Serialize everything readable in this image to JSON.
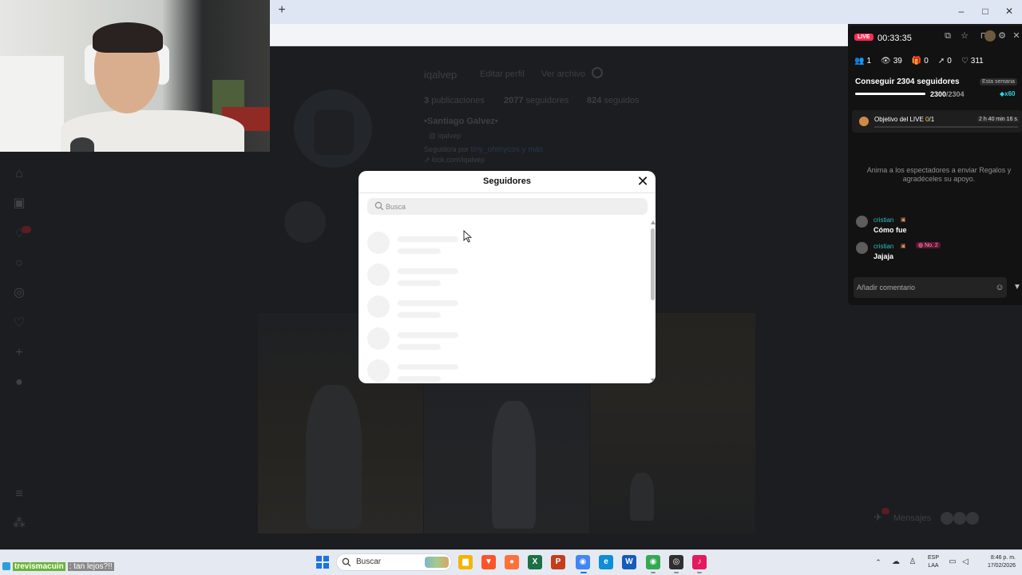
{
  "browser": {
    "new_tab_glyph": "+",
    "win_min_glyph": "–",
    "win_max_glyph": "□",
    "win_close_glyph": "✕"
  },
  "profile": {
    "username": "iqalvep",
    "edit_button": "Editar perfil",
    "archive_button": "Ver archivo",
    "stats": [
      {
        "value": "3",
        "label": "publicaciones"
      },
      {
        "value": "2077",
        "label": "seguidores"
      },
      {
        "value": "824",
        "label": "seguidos"
      }
    ],
    "display_name": "•Santiago Galvez•",
    "threads_handle": "iqalvep",
    "followed_by_prefix": "Seguido/a por",
    "followed_by_names": "tiny_ohmycos y más",
    "link": "kick.com/iqalvep"
  },
  "messages_pill": {
    "label": "Mensajes"
  },
  "modal": {
    "title": "Seguidores",
    "close_glyph": "✕",
    "search_placeholder": "Busca"
  },
  "live": {
    "badge": "LIVE",
    "timer": "00:33:35",
    "stats": [
      {
        "icon": "users-icon",
        "glyph": "👥",
        "value": "1"
      },
      {
        "icon": "eye-icon",
        "glyph": "👁",
        "value": "39"
      },
      {
        "icon": "gift-icon",
        "glyph": "🎁",
        "value": "0"
      },
      {
        "icon": "user-add-icon",
        "glyph": "➚",
        "value": "0"
      },
      {
        "icon": "heart-icon",
        "glyph": "♡",
        "value": "311"
      }
    ],
    "goal": {
      "title": "Conseguir 2304 seguidores",
      "period": "Esta semana",
      "current": "2300",
      "total": "/2304",
      "progress": 0.998,
      "reward": "x60"
    },
    "live_goal": {
      "label": "Objetivo del LIVE",
      "progress_current": "0",
      "progress_total": "/1",
      "time_left": "2 h 40 min 16 s"
    },
    "hint": "Anima a los espectadores a enviar Regalos y agradéceles su apoyo.",
    "chat": [
      {
        "name": "cristian",
        "text": "Cómo fue",
        "rank": ""
      },
      {
        "name": "cristian",
        "text": "Jajaja",
        "rank": "No. 2"
      }
    ],
    "comment_placeholder": "Añadir comentario"
  },
  "taskbar": {
    "ticker_user": "trevismacuin",
    "ticker_message": ": tan lejos?!!",
    "search_label": "Buscar",
    "lang_line1": "ESP",
    "lang_line2": "LAA",
    "time": "8:46 p. m.",
    "date": "17/02/2026",
    "apps": [
      {
        "name": "file-explorer-icon",
        "glyph": "▆",
        "color": "#f4b400"
      },
      {
        "name": "brave-icon",
        "glyph": "▼",
        "color": "#fb542b"
      },
      {
        "name": "firefox-icon",
        "glyph": "●",
        "color": "#ff7139"
      },
      {
        "name": "excel-icon",
        "glyph": "X",
        "color": "#1d7044"
      },
      {
        "name": "powerpoint-icon",
        "glyph": "P",
        "color": "#c43e1c"
      },
      {
        "name": "chrome-icon",
        "glyph": "◉",
        "color": "#4285f4"
      },
      {
        "name": "edge-icon",
        "glyph": "e",
        "color": "#0c8fd6"
      },
      {
        "name": "word-icon",
        "glyph": "W",
        "color": "#185abd"
      },
      {
        "name": "chrome-profile-icon",
        "glyph": "◉",
        "color": "#34a853"
      },
      {
        "name": "obs-icon",
        "glyph": "◎",
        "color": "#302e31"
      },
      {
        "name": "tiktok-icon",
        "glyph": "♪",
        "color": "#e5195e"
      }
    ]
  }
}
